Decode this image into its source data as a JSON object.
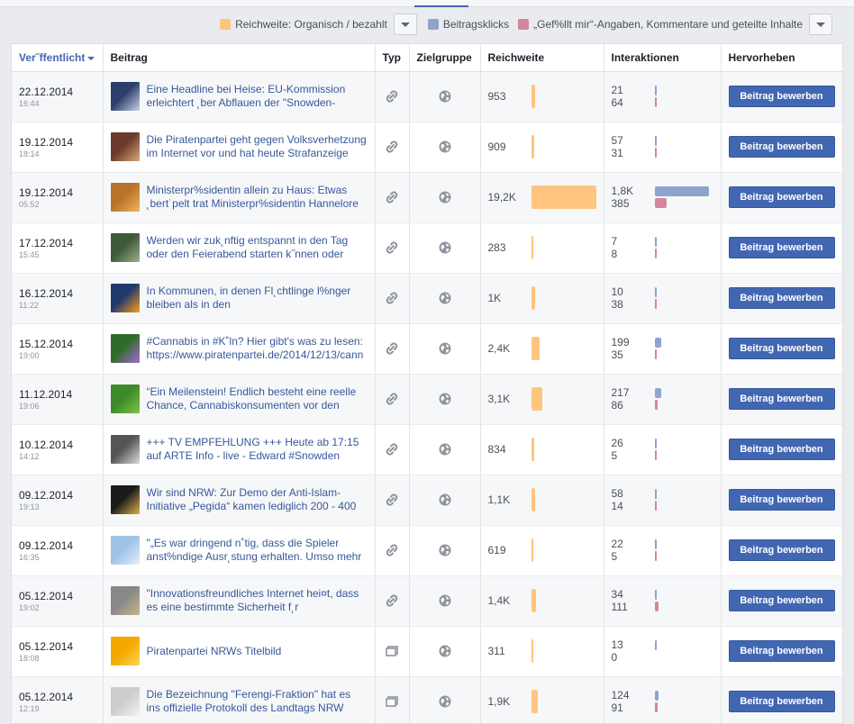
{
  "legend": [
    {
      "label": "Reichweite: Organisch / bezahlt",
      "color": "#ffc57e"
    },
    {
      "label": "Beitragsklicks",
      "color": "#8fa3cc"
    },
    {
      "label": "„Gef%llt mir“-Angaben, Kommentare und geteilte Inhalte",
      "color": "#d3869b"
    }
  ],
  "columns": {
    "published": "Ver˝ffentlicht",
    "post": "Beitrag",
    "type": "Typ",
    "audience": "Zielgruppe",
    "reach": "Reichweite",
    "interactions": "Interaktionen",
    "boost": "Hervorheben"
  },
  "boost_label": "Beitrag bewerben",
  "reach_max": 19200,
  "inter_max": 1800,
  "rows": [
    {
      "date": "22.12.2014",
      "time": "16:44",
      "text": "Eine Headline bei Heise: EU-Kommission erleichtert ˛ber Abflauen der \"Snowden-",
      "type": "link",
      "reach_label": "953",
      "reach": 953,
      "clicks_label": "21",
      "clicks": 21,
      "likes_label": "64",
      "likes": 64,
      "thumb": [
        "#2c3e6b",
        "#c9d2e6"
      ]
    },
    {
      "date": "19.12.2014",
      "time": "18:14",
      "text": "Die Piratenpartei geht gegen Volksverhetzung im Internet vor und hat heute Strafanzeige",
      "type": "link",
      "reach_label": "909",
      "reach": 909,
      "clicks_label": "57",
      "clicks": 57,
      "likes_label": "31",
      "likes": 31,
      "thumb": [
        "#6b3a2a",
        "#d9a77c"
      ]
    },
    {
      "date": "19.12.2014",
      "time": "05:52",
      "text": "Ministerpr%sidentin allein zu Haus: Etwas ˛bert˙pelt trat Ministerpr%sidentin Hannelore",
      "type": "link",
      "reach_label": "19,2K",
      "reach": 19200,
      "clicks_label": "1,8K",
      "clicks": 1800,
      "likes_label": "385",
      "likes": 385,
      "thumb": [
        "#b8742a",
        "#f0b45a"
      ]
    },
    {
      "date": "17.12.2014",
      "time": "15:45",
      "text": "Werden wir zuk˛nftig entspannt in den Tag oder den Feierabend starten k˝nnen oder",
      "type": "link",
      "reach_label": "283",
      "reach": 283,
      "clicks_label": "7",
      "clicks": 7,
      "likes_label": "8",
      "likes": 8,
      "thumb": [
        "#3e5a3a",
        "#9bb08a"
      ]
    },
    {
      "date": "16.12.2014",
      "time": "11:22",
      "text": "In Kommunen, in denen Fl˛chtlinge l%nger bleiben als in den",
      "type": "link",
      "reach_label": "1K",
      "reach": 1000,
      "clicks_label": "10",
      "clicks": 10,
      "likes_label": "38",
      "likes": 38,
      "thumb": [
        "#1f3a6b",
        "#ff9b1a"
      ]
    },
    {
      "date": "15.12.2014",
      "time": "19:00",
      "text": "#Cannabis in #K˚ln? Hier gibt's was zu lesen: https://www.piratenpartei.de/2014/12/13/cann",
      "type": "link",
      "reach_label": "2,4K",
      "reach": 2400,
      "clicks_label": "199",
      "clicks": 199,
      "likes_label": "35",
      "likes": 35,
      "thumb": [
        "#2f6b2a",
        "#a36bd1"
      ]
    },
    {
      "date": "11.12.2014",
      "time": "19:06",
      "text": "“Ein Meilenstein! Endlich besteht eine reelle Chance, Cannabiskonsumenten vor den",
      "type": "link",
      "reach_label": "3,1K",
      "reach": 3100,
      "clicks_label": "217",
      "clicks": 217,
      "likes_label": "86",
      "likes": 86,
      "thumb": [
        "#3d8a2a",
        "#7cc24a"
      ]
    },
    {
      "date": "10.12.2014",
      "time": "14:12",
      "text": "+++ TV EMPFEHLUNG +++ Heute ab 17:15 auf ARTE Info - live - Edward #Snowden",
      "type": "link",
      "reach_label": "834",
      "reach": 834,
      "clicks_label": "26",
      "clicks": 26,
      "likes_label": "5",
      "likes": 5,
      "thumb": [
        "#555555",
        "#dddddd"
      ]
    },
    {
      "date": "09.12.2014",
      "time": "19:13",
      "text": "Wir sind NRW: Zur Demo der Anti-Islam-Initiative „Pegida“ kamen lediglich 200 - 400",
      "type": "link",
      "reach_label": "1,1K",
      "reach": 1100,
      "clicks_label": "58",
      "clicks": 58,
      "likes_label": "14",
      "likes": 14,
      "thumb": [
        "#1a1a1a",
        "#e3b04b"
      ]
    },
    {
      "date": "09.12.2014",
      "time": "16:35",
      "text": "\"„Es war dringend n˚tig, dass die Spieler anst%ndige Ausr˛stung erhalten. Umso mehr",
      "type": "link",
      "reach_label": "619",
      "reach": 619,
      "clicks_label": "22",
      "clicks": 22,
      "likes_label": "5",
      "likes": 5,
      "thumb": [
        "#9ec3e6",
        "#e6eef7"
      ]
    },
    {
      "date": "05.12.2014",
      "time": "19:02",
      "text": "\"Innovationsfreundliches Internet hei¤t, dass es eine bestimmte Sicherheit f˛r",
      "type": "link",
      "reach_label": "1,4K",
      "reach": 1400,
      "clicks_label": "34",
      "clicks": 34,
      "likes_label": "111",
      "likes": 111,
      "thumb": [
        "#888888",
        "#c9b48a"
      ]
    },
    {
      "date": "05.12.2014",
      "time": "18:08",
      "text": "Piratenpartei NRWs Titelbild",
      "type": "photo",
      "reach_label": "311",
      "reach": 311,
      "clicks_label": "13",
      "clicks": 13,
      "likes_label": "0",
      "likes": 0,
      "thumb": [
        "#f2a800",
        "#ffd34d"
      ]
    },
    {
      "date": "05.12.2014",
      "time": "12:19",
      "text": "Die Bezeichnung \"Ferengi-Fraktion\" hat es ins offizielle Protokoll des Landtags NRW",
      "type": "photo",
      "reach_label": "1,9K",
      "reach": 1900,
      "clicks_label": "124",
      "clicks": 124,
      "likes_label": "91",
      "likes": 91,
      "thumb": [
        "#cccccc",
        "#f2f2f2"
      ]
    }
  ]
}
